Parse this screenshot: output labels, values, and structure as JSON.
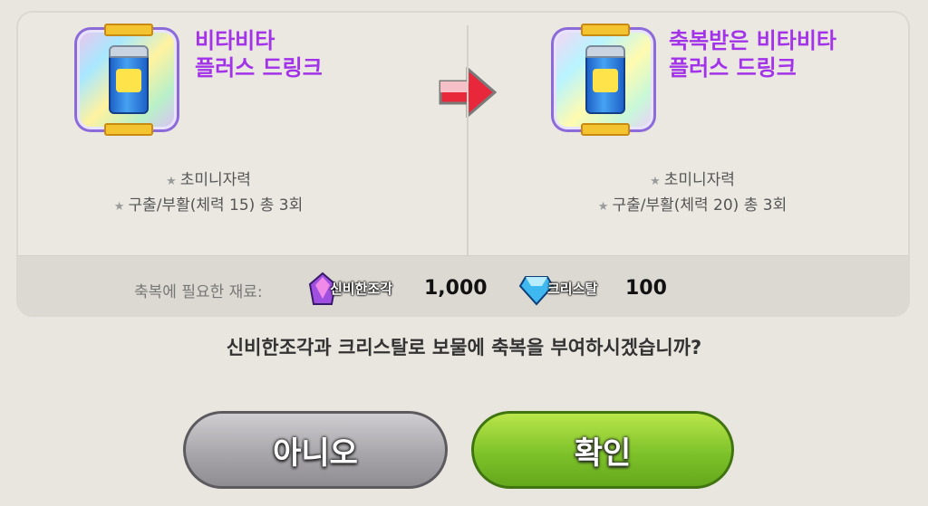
{
  "before": {
    "name": "비타비타\n플러스 드링크",
    "stats": [
      "초미니자력",
      "구출/부활(체력 15) 총 3회"
    ]
  },
  "after": {
    "name": "축복받은 비타비타\n플러스 드링크",
    "stats": [
      "초미니자력",
      "구출/부활(체력 20) 총 3회"
    ]
  },
  "cost": {
    "label": "축복에 필요한 재료:",
    "resources": [
      {
        "name": "신비한조각",
        "amount": "1,000",
        "icon": "mystic-shard-icon"
      },
      {
        "name": "크리스탈",
        "amount": "100",
        "icon": "crystal-icon"
      }
    ]
  },
  "question": "신비한조각과 크리스탈로 보물에 축복을 부여하시겠습니까?",
  "buttons": {
    "no": "아니오",
    "yes": "확인"
  },
  "colors": {
    "item_name": "#a233e8",
    "yes_button": "#7ec22a",
    "no_button": "#a8a6aa"
  }
}
